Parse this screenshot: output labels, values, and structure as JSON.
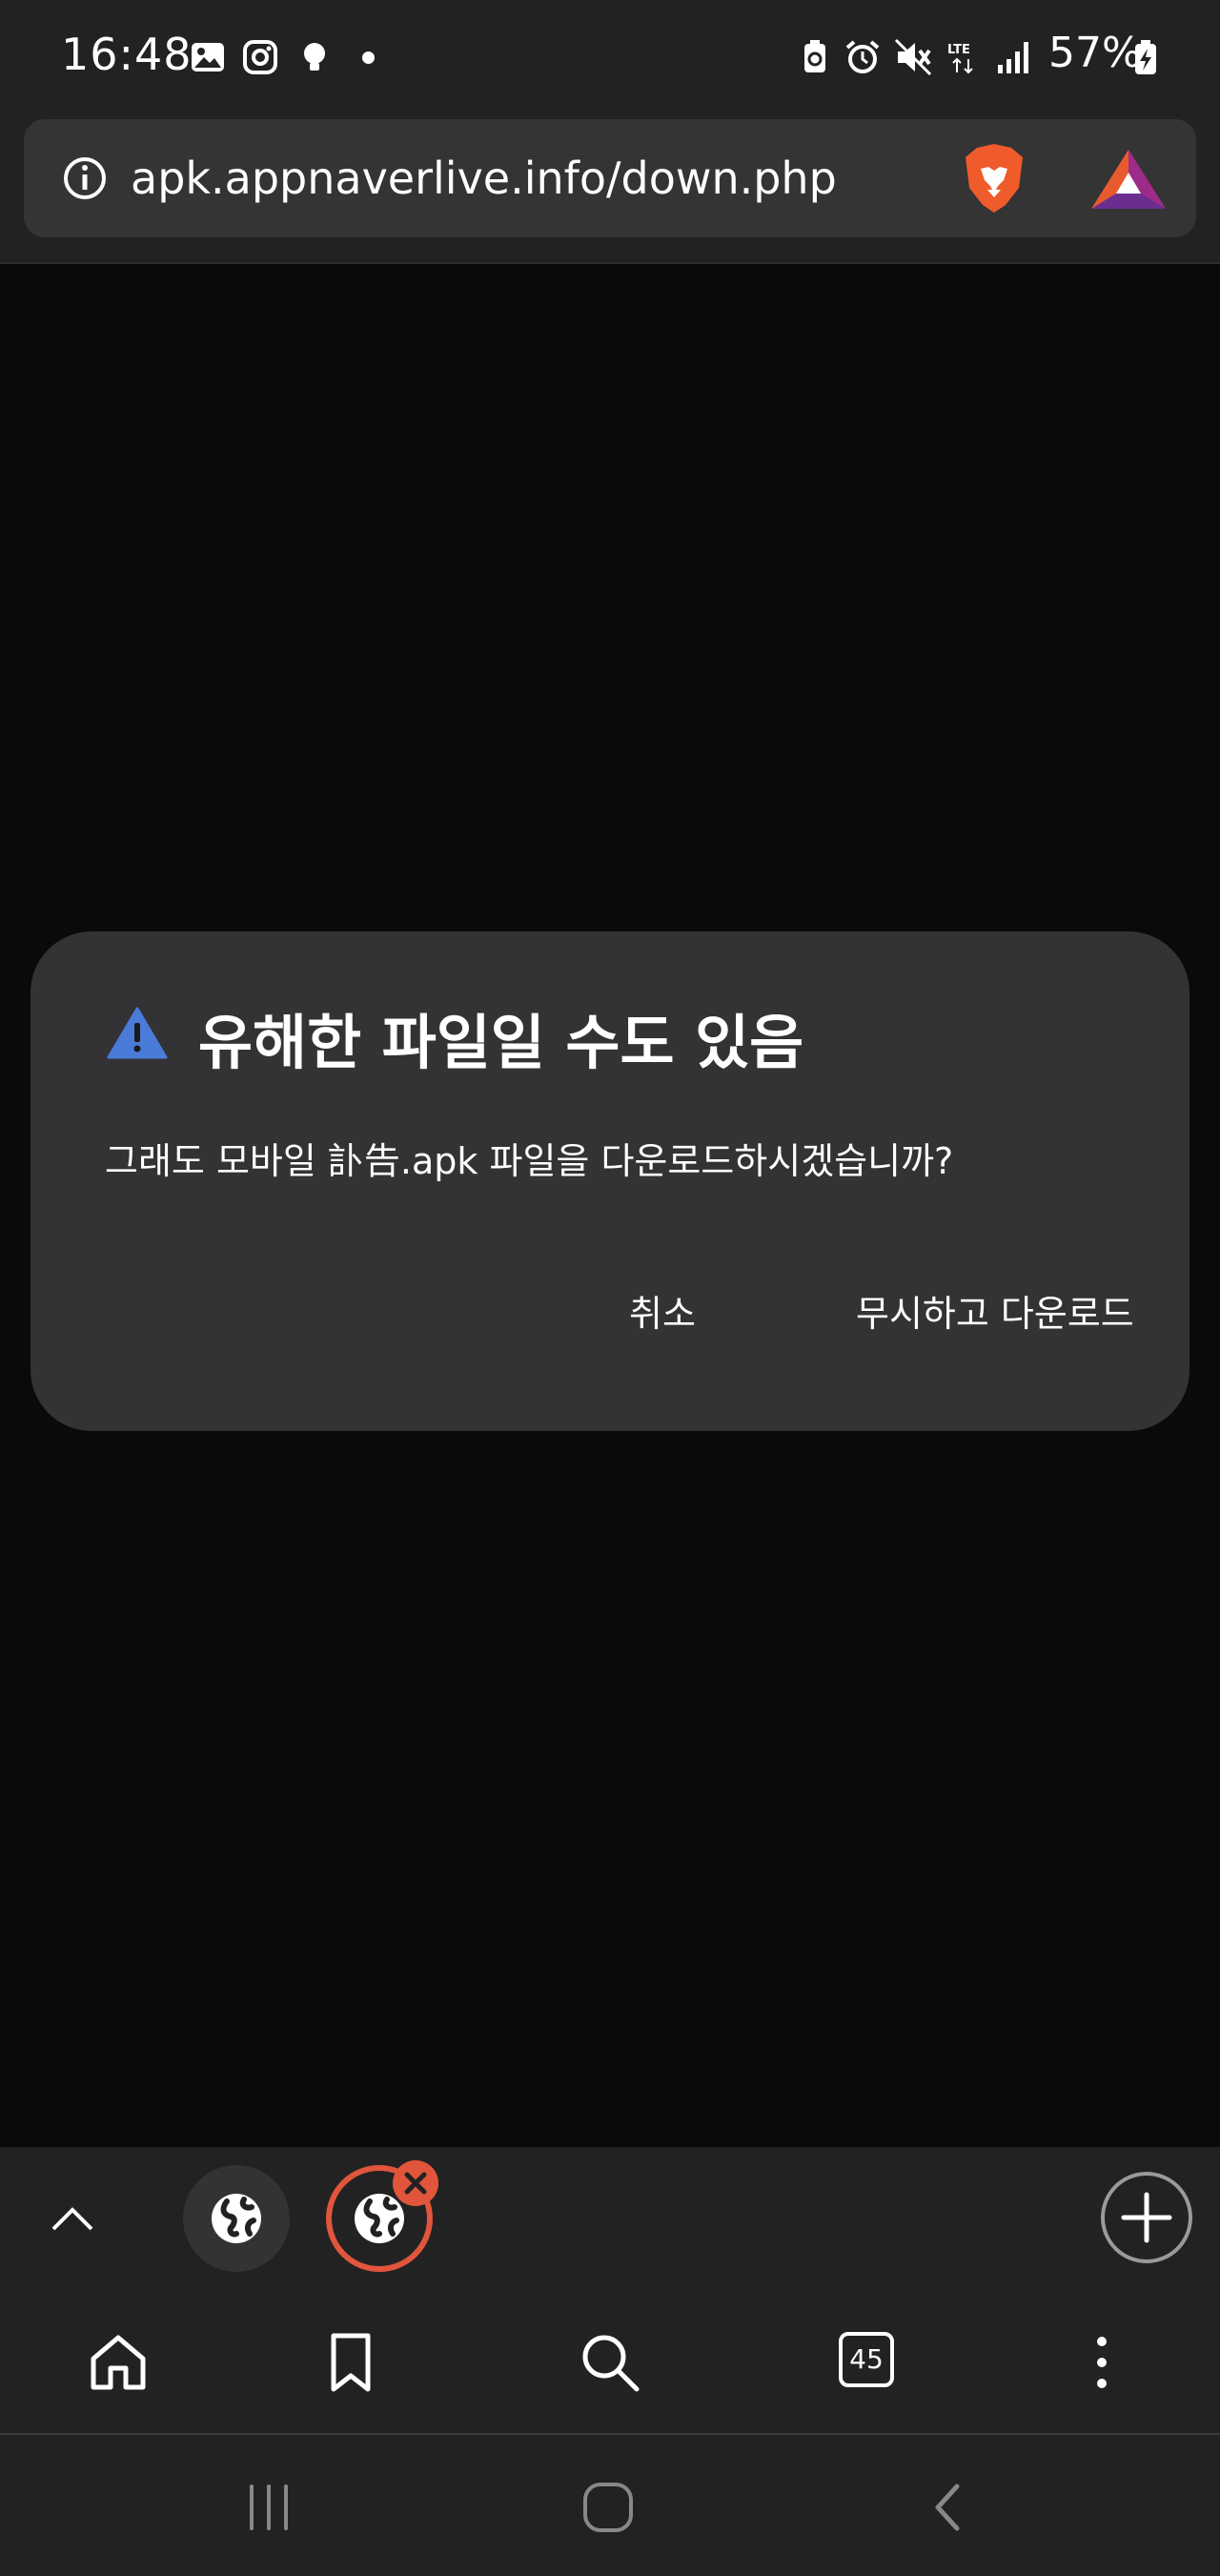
{
  "status_bar": {
    "time": "16:48",
    "battery": "57%"
  },
  "url_bar": {
    "url": "apk.appnaverlive.info/down.php"
  },
  "dialog": {
    "title": "유해한 파일일 수도 있음",
    "message": "그래도 모바일 訃告.apk 파일을 다운로드하시겠습니까?",
    "cancel_label": "취소",
    "download_label": "무시하고 다운로드"
  },
  "toolbar": {
    "tab_count": "45"
  },
  "colors": {
    "accent": "#e0553c",
    "warning": "#4a7bd8",
    "dialog_bg": "#333234"
  }
}
